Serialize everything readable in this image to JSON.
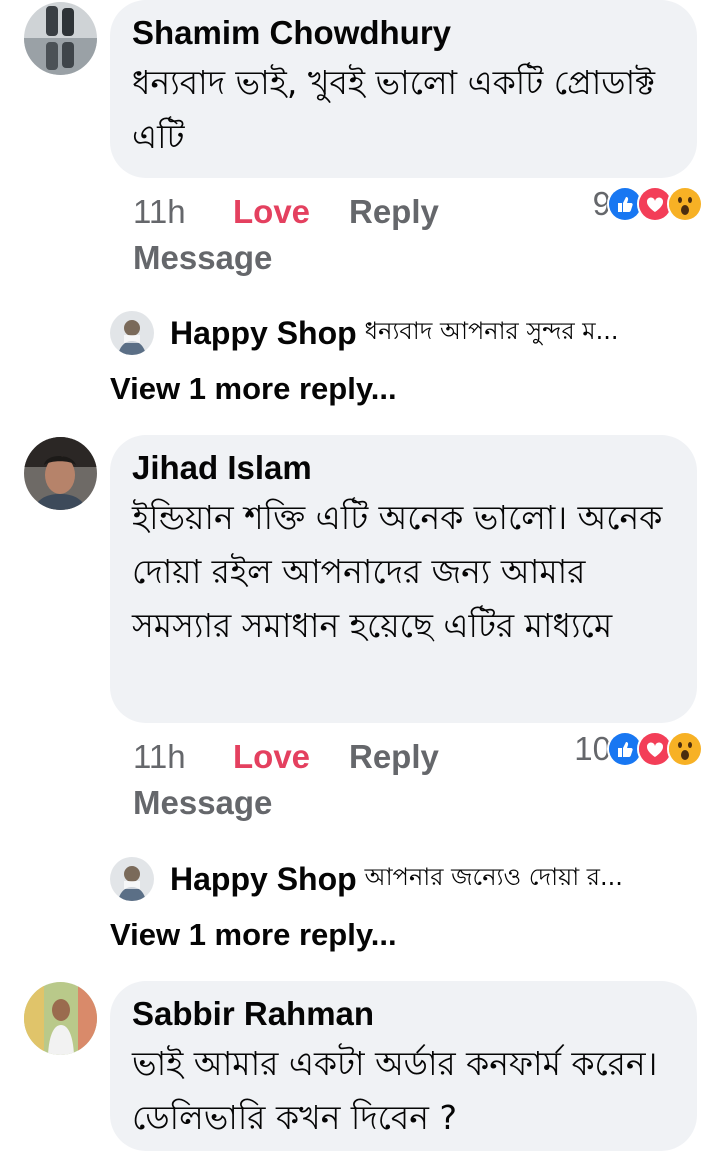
{
  "comments": [
    {
      "author": "Shamim Chowdhury",
      "text": "ধন্যবাদ ভাই, খুবই ভালো একটি প্রোডাক্ট  এটি",
      "time": "11h",
      "love_label": "Love",
      "reply_label": "Reply",
      "message_label": "Message",
      "reaction_count": "9",
      "reactions": [
        "like-icon",
        "love-icon",
        "wow-icon"
      ],
      "reply_preview": {
        "name": "Happy Shop",
        "snippet": "ধন্যবাদ আপনার সুন্দর ম..."
      },
      "view_more": "View 1 more reply..."
    },
    {
      "author": "Jihad Islam",
      "text": "ইন্ডিয়ান শক্তি এটি অনেক ভালো। অনেক দোয়া রইল আপনাদের জন্য আমার সমস্যার সমাধান হয়েছে এটির মাধ্যমে",
      "time": "11h",
      "love_label": "Love",
      "reply_label": "Reply",
      "message_label": "Message",
      "reaction_count": "10",
      "reactions": [
        "like-icon",
        "love-icon",
        "wow-icon"
      ],
      "reply_preview": {
        "name": "Happy Shop",
        "snippet": "আপনার জন্যেও দোয়া র..."
      },
      "view_more": "View 1 more reply..."
    },
    {
      "author": "Sabbir Rahman",
      "text": "ভাই আমার একটা অর্ডার কনফার্ম করেন। ডেলিভারি কখন দিবেন ?"
    }
  ],
  "colors": {
    "love": "#e4405f",
    "meta": "#65676b",
    "bubble": "#f0f2f5",
    "like": "#1877f2"
  }
}
